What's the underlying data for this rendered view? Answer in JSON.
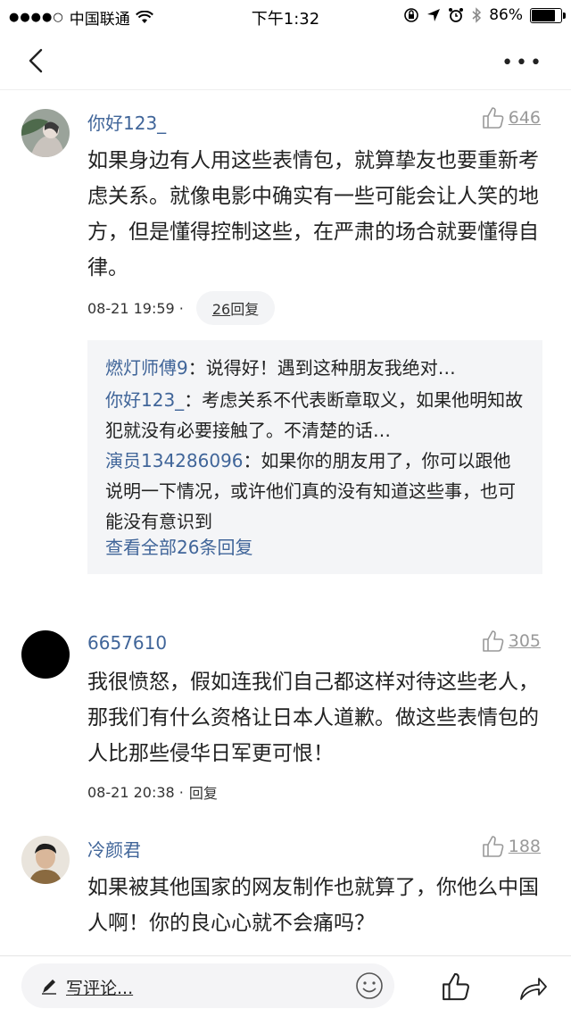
{
  "status_bar": {
    "carrier": "中国联通",
    "time": "下午1:32",
    "battery": "86%",
    "battery_level": 0.86
  },
  "nav": {
    "back_icon": "chevron-left-icon",
    "more_icon": "more-dots-icon"
  },
  "comments": [
    {
      "user": "你好123_",
      "likes": "646",
      "text": "如果身边有人用这些表情包，就算挚友也要重新考虑关系。就像电影中确实有一些可能会让人笑的地方，但是懂得控制这些，在严肃的场合就要懂得自律。",
      "time": "08-21 19:59 ·",
      "reply_count": "26",
      "reply_label": "回复",
      "replies": [
        {
          "name": "燃灯师傅9",
          "text": "：说得好！遇到这种朋友我绝对…"
        },
        {
          "name": "你好123_",
          "text": "：考虑关系不代表断章取义，如果他明知故犯就没有必要接触了。不清楚的话…"
        },
        {
          "name": "演员134286096",
          "text": "：如果你的朋友用了，你可以跟他说明一下情况，或许他们真的没有知道这些事，也可能没有意识到"
        }
      ],
      "view_all": "查看全部26条回复"
    },
    {
      "user": "6657610",
      "likes": "305",
      "text": "我很愤怒，假如连我们自己都这样对待这些老人，那我们有什么资格让日本人道歉。做这些表情包的人比那些侵华日军更可恨！",
      "time": "08-21 20:38 ·",
      "reply_label": "回复"
    },
    {
      "user": "冷颜君",
      "likes": "188",
      "text": "如果被其他国家的网友制作也就算了，你他么中国人啊！你的良心心就不会痛吗？"
    }
  ],
  "bottom_bar": {
    "placeholder": "写评论...",
    "icons": [
      "pen-icon",
      "emoji-icon",
      "thumbs-up-icon",
      "share-icon"
    ]
  },
  "colors": {
    "username": "#406599",
    "reply_bg": "#f4f5f7",
    "text": "#222222",
    "muted": "#999999"
  }
}
